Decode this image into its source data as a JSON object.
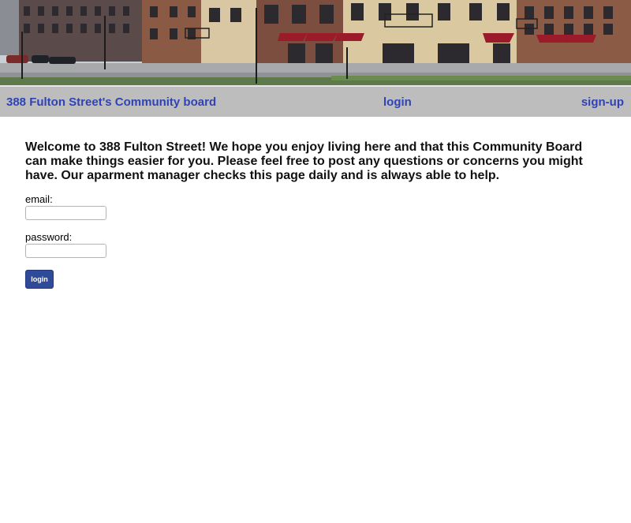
{
  "header": {
    "image_alt": "Apartment building street view"
  },
  "nav": {
    "brand": "388 Fulton Street's Community board",
    "login": "login",
    "signup": "sign-up"
  },
  "main": {
    "intro": "Welcome to 388 Fulton Street! We hope you enjoy living here and that this Community Board can make things easier for you. Please feel free to post any questions or concerns you might have. Our aparment manager checks this page daily and is always able to help."
  },
  "form": {
    "email_label": "email:",
    "email_value": "",
    "password_label": "password:",
    "password_value": "",
    "submit_label": "login"
  },
  "colors": {
    "nav_background": "#bdbdbd",
    "link": "#2e43b7",
    "button": "#2f4a98"
  }
}
